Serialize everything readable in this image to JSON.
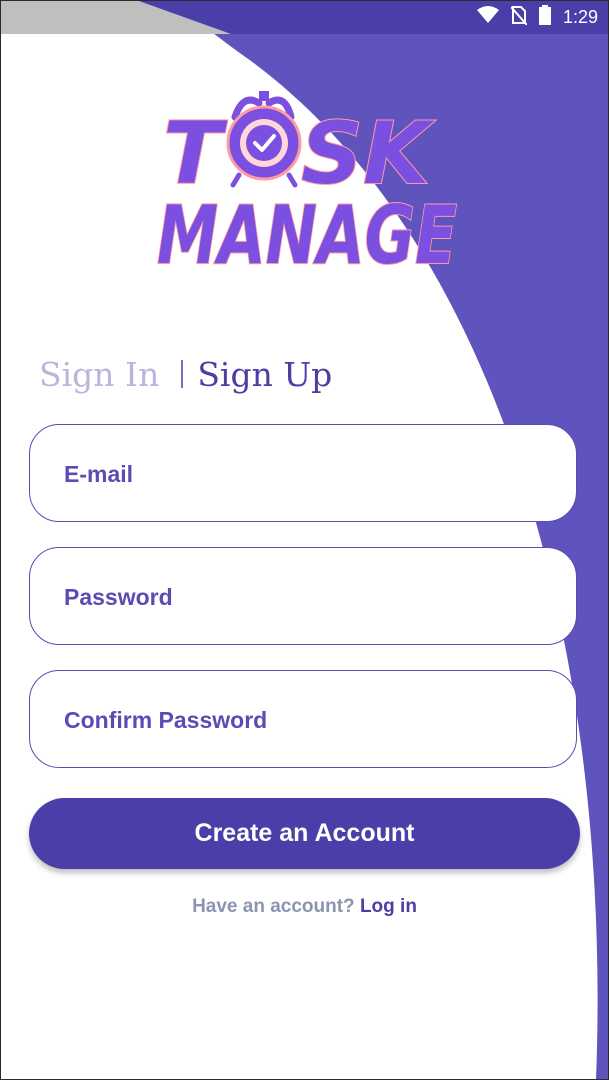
{
  "status_bar": {
    "time": "1:29",
    "icons": [
      "wifi-icon",
      "no-sim-icon",
      "battery-icon"
    ]
  },
  "logo": {
    "line1_left": "T",
    "line1_right": "SK",
    "line2": "MANAGE",
    "icon": "alarm-clock-check-icon"
  },
  "tabs": {
    "sign_in": "Sign In",
    "sign_up": "Sign Up",
    "active": "sign_up"
  },
  "form": {
    "email_placeholder": "E-mail",
    "password_placeholder": "Password",
    "confirm_password_placeholder": "Confirm Password",
    "email_value": "",
    "password_value": "",
    "confirm_password_value": ""
  },
  "actions": {
    "create_account": "Create an Account",
    "have_account_prompt": "Have an account?",
    "login_link": "Log in"
  },
  "colors": {
    "primary": "#4a3fa8",
    "accent_purple": "#7b4fe0",
    "logo_outline": "#ff9aa2",
    "inactive_tab": "#bdb4dd",
    "muted_text": "#8a95b0",
    "background": "#ffffff"
  }
}
